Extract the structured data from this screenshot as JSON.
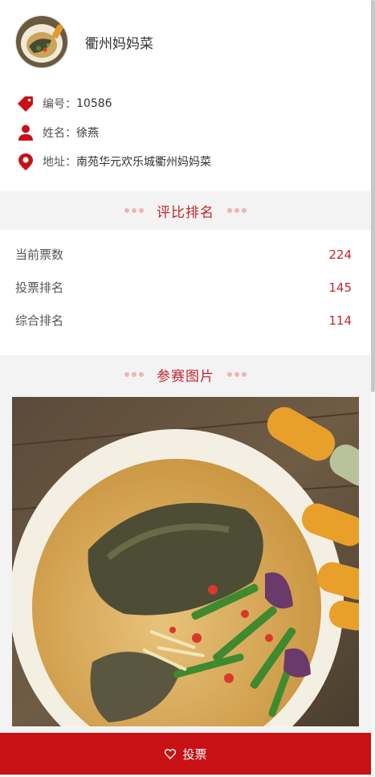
{
  "profile": {
    "shop_name": "衢州妈妈菜",
    "number_label": "编号：",
    "number_value": "10586",
    "name_label": "姓名：",
    "name_value": "徐燕",
    "address_label": "地址：",
    "address_value": "南苑华元欢乐城衢州妈妈菜"
  },
  "ranking_section": {
    "title": "评比排名"
  },
  "ranking": [
    {
      "label": "当前票数",
      "value": "224"
    },
    {
      "label": "投票排名",
      "value": "145"
    },
    {
      "label": "综合排名",
      "value": "114"
    }
  ],
  "photo_section": {
    "title": "参赛图片"
  },
  "vote_button": {
    "label": "投票"
  },
  "colors": {
    "accent": "#c0282d",
    "vote_bar": "#c71115",
    "dots": "#f0b3b3"
  },
  "icons": {
    "number": "tag-icon",
    "name": "user-icon",
    "address": "location-pin-icon",
    "vote": "heart-icon"
  }
}
